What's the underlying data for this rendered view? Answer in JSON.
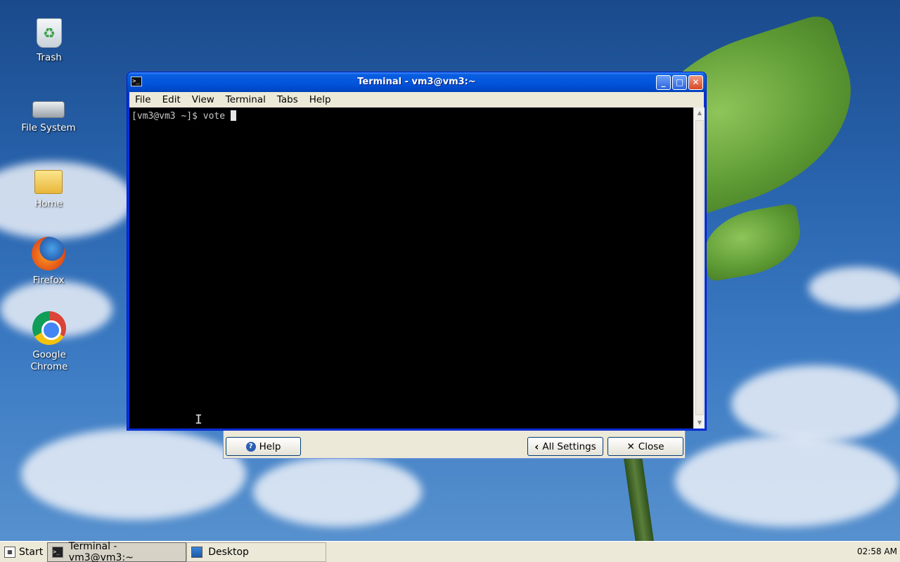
{
  "desktop": {
    "icons": [
      {
        "label": "Trash",
        "icon": "trash-icon"
      },
      {
        "label": "File System",
        "icon": "drive-icon"
      },
      {
        "label": "Home",
        "icon": "folder-icon"
      },
      {
        "label": "Firefox",
        "icon": "firefox-icon"
      },
      {
        "label": "Google Chrome",
        "icon": "chrome-icon"
      }
    ]
  },
  "settings_dialog": {
    "help_label": "Help",
    "all_settings_label": "All Settings",
    "close_label": "Close"
  },
  "terminal": {
    "title": "Terminal - vm3@vm3:~",
    "menu": [
      "File",
      "Edit",
      "View",
      "Terminal",
      "Tabs",
      "Help"
    ],
    "prompt_line": "[vm3@vm3 ~]$ vote "
  },
  "taskbar": {
    "start_label": "Start",
    "buttons": [
      {
        "label": "Terminal - vm3@vm3:~",
        "active": true
      },
      {
        "label": "Desktop",
        "active": false
      }
    ],
    "clock": "02:58 AM"
  },
  "colors": {
    "titlebar": "#0356dd",
    "terminal_bg": "#000000",
    "chrome_bg": "#ece9d8"
  }
}
